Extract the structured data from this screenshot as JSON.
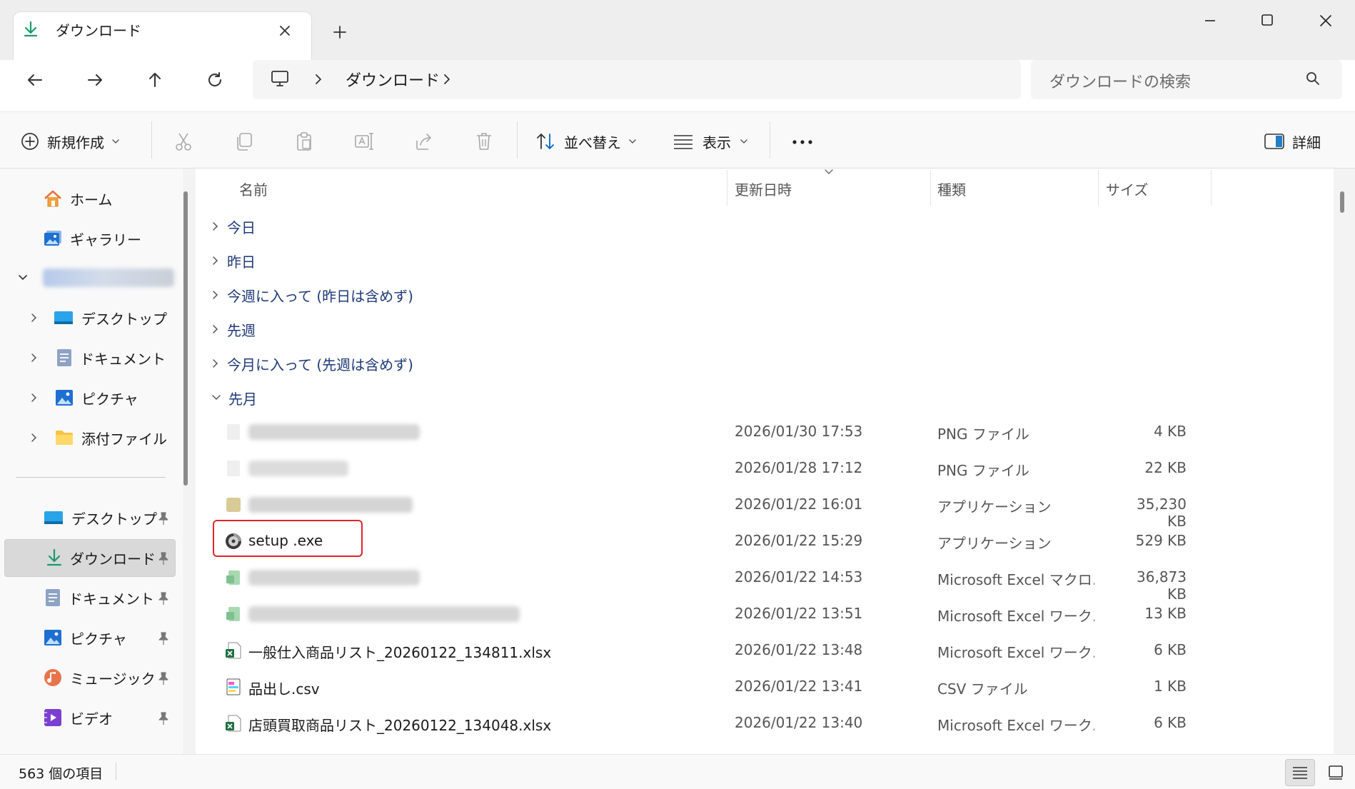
{
  "window": {
    "tab_title": "ダウンロード",
    "tab_icon": "download-icon"
  },
  "address": {
    "crumb": "ダウンロード",
    "pc_icon": "computer-icon"
  },
  "search": {
    "placeholder": "ダウンロードの検索"
  },
  "toolbar": {
    "new_label": "新規作成",
    "sort_label": "並べ替え",
    "view_label": "表示",
    "details_label": "詳細",
    "icons": [
      "cut-icon",
      "copy-icon",
      "paste-icon",
      "rename-icon",
      "share-icon",
      "delete-icon"
    ]
  },
  "sidebar": {
    "home": "ホーム",
    "gallery": "ギャラリー",
    "tree": [
      {
        "label": "デスクトップ",
        "icon": "desktop-icon"
      },
      {
        "label": "ドキュメント",
        "icon": "documents-icon"
      },
      {
        "label": "ピクチャ",
        "icon": "pictures-icon"
      },
      {
        "label": "添付ファイル",
        "icon": "folder-icon"
      }
    ],
    "quick": [
      {
        "label": "デスクトップ",
        "icon": "desktop-icon"
      },
      {
        "label": "ダウンロード",
        "icon": "download-icon"
      },
      {
        "label": "ドキュメント",
        "icon": "documents-icon"
      },
      {
        "label": "ピクチャ",
        "icon": "pictures-icon"
      },
      {
        "label": "ミュージック",
        "icon": "music-icon"
      },
      {
        "label": "ビデオ",
        "icon": "video-icon"
      }
    ]
  },
  "columns": {
    "name": "名前",
    "modified": "更新日時",
    "type": "種類",
    "size": "サイズ"
  },
  "groups": {
    "today": "今日",
    "yesterday": "昨日",
    "this_week": "今週に入って (昨日は含めず)",
    "last_week": "先週",
    "this_month": "今月に入って (先週は含めず)",
    "last_month": "先月"
  },
  "files": [
    {
      "name": "",
      "date": "2026/01/30 17:53",
      "type": "PNG ファイル",
      "size": "4 KB",
      "icon": "image-file-icon"
    },
    {
      "name": "",
      "date": "2026/01/28 17:12",
      "type": "PNG ファイル",
      "size": "22 KB",
      "icon": "image-file-icon"
    },
    {
      "name": "",
      "date": "2026/01/22 16:01",
      "type": "アプリケーション",
      "size": "35,230 KB",
      "icon": "application-icon"
    },
    {
      "name": "setup  .exe",
      "date": "2026/01/22 15:29",
      "type": "アプリケーション",
      "size": "529 KB",
      "icon": "installer-disc-icon"
    },
    {
      "name": "",
      "date": "2026/01/22 14:53",
      "type": "Microsoft Excel マクロ…",
      "size": "36,873 KB",
      "icon": "excel-file-icon"
    },
    {
      "name": "",
      "date": "2026/01/22 13:51",
      "type": "Microsoft Excel ワーク…",
      "size": "13 KB",
      "icon": "excel-file-icon"
    },
    {
      "name": "一般仕入商品リスト_20260122_134811.xlsx",
      "date": "2026/01/22 13:48",
      "type": "Microsoft Excel ワーク…",
      "size": "6 KB",
      "icon": "excel-file-icon"
    },
    {
      "name": "品出し.csv",
      "date": "2026/01/22 13:41",
      "type": "CSV ファイル",
      "size": "1 KB",
      "icon": "csv-file-icon"
    },
    {
      "name": "店頭買取商品リスト_20260122_134048.xlsx",
      "date": "2026/01/22 13:40",
      "type": "Microsoft Excel ワーク…",
      "size": "6 KB",
      "icon": "excel-file-icon"
    }
  ],
  "status": {
    "item_count": "563 個の項目"
  },
  "colors": {
    "accent": "#0067c0",
    "highlight_border": "#e0242a",
    "group_text": "#1f3a78"
  }
}
